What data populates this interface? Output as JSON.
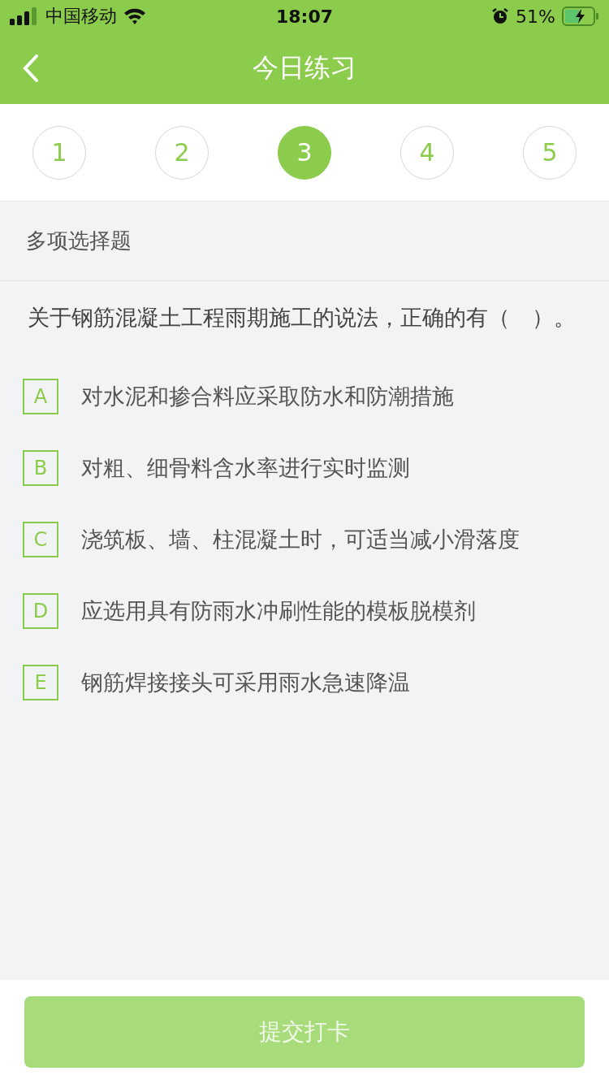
{
  "status_bar": {
    "carrier": "中国移动",
    "time": "18:07",
    "battery": "51%"
  },
  "nav": {
    "title": "今日练习"
  },
  "question_tabs": [
    {
      "label": "1",
      "selected": false
    },
    {
      "label": "2",
      "selected": false
    },
    {
      "label": "3",
      "selected": true
    },
    {
      "label": "4",
      "selected": false
    },
    {
      "label": "5",
      "selected": false
    }
  ],
  "question": {
    "type": "多项选择题",
    "text": "关于钢筋混凝土工程雨期施工的说法，正确的有（　）。",
    "options": [
      {
        "letter": "A",
        "text": "对水泥和掺合料应采取防水和防潮措施",
        "selected": false
      },
      {
        "letter": "B",
        "text": "对粗、细骨料含水率进行实时监测",
        "selected": false
      },
      {
        "letter": "C",
        "text": "浇筑板、墙、柱混凝土时，可适当减小滑落度",
        "selected": false
      },
      {
        "letter": "D",
        "text": "应选用具有防雨水冲刷性能的模板脱模剂",
        "selected": false
      },
      {
        "letter": "E",
        "text": "钢筋焊接接头可采用雨水急速降温",
        "selected": false
      }
    ]
  },
  "submit_button": {
    "label": "提交打卡",
    "disabled": true
  }
}
